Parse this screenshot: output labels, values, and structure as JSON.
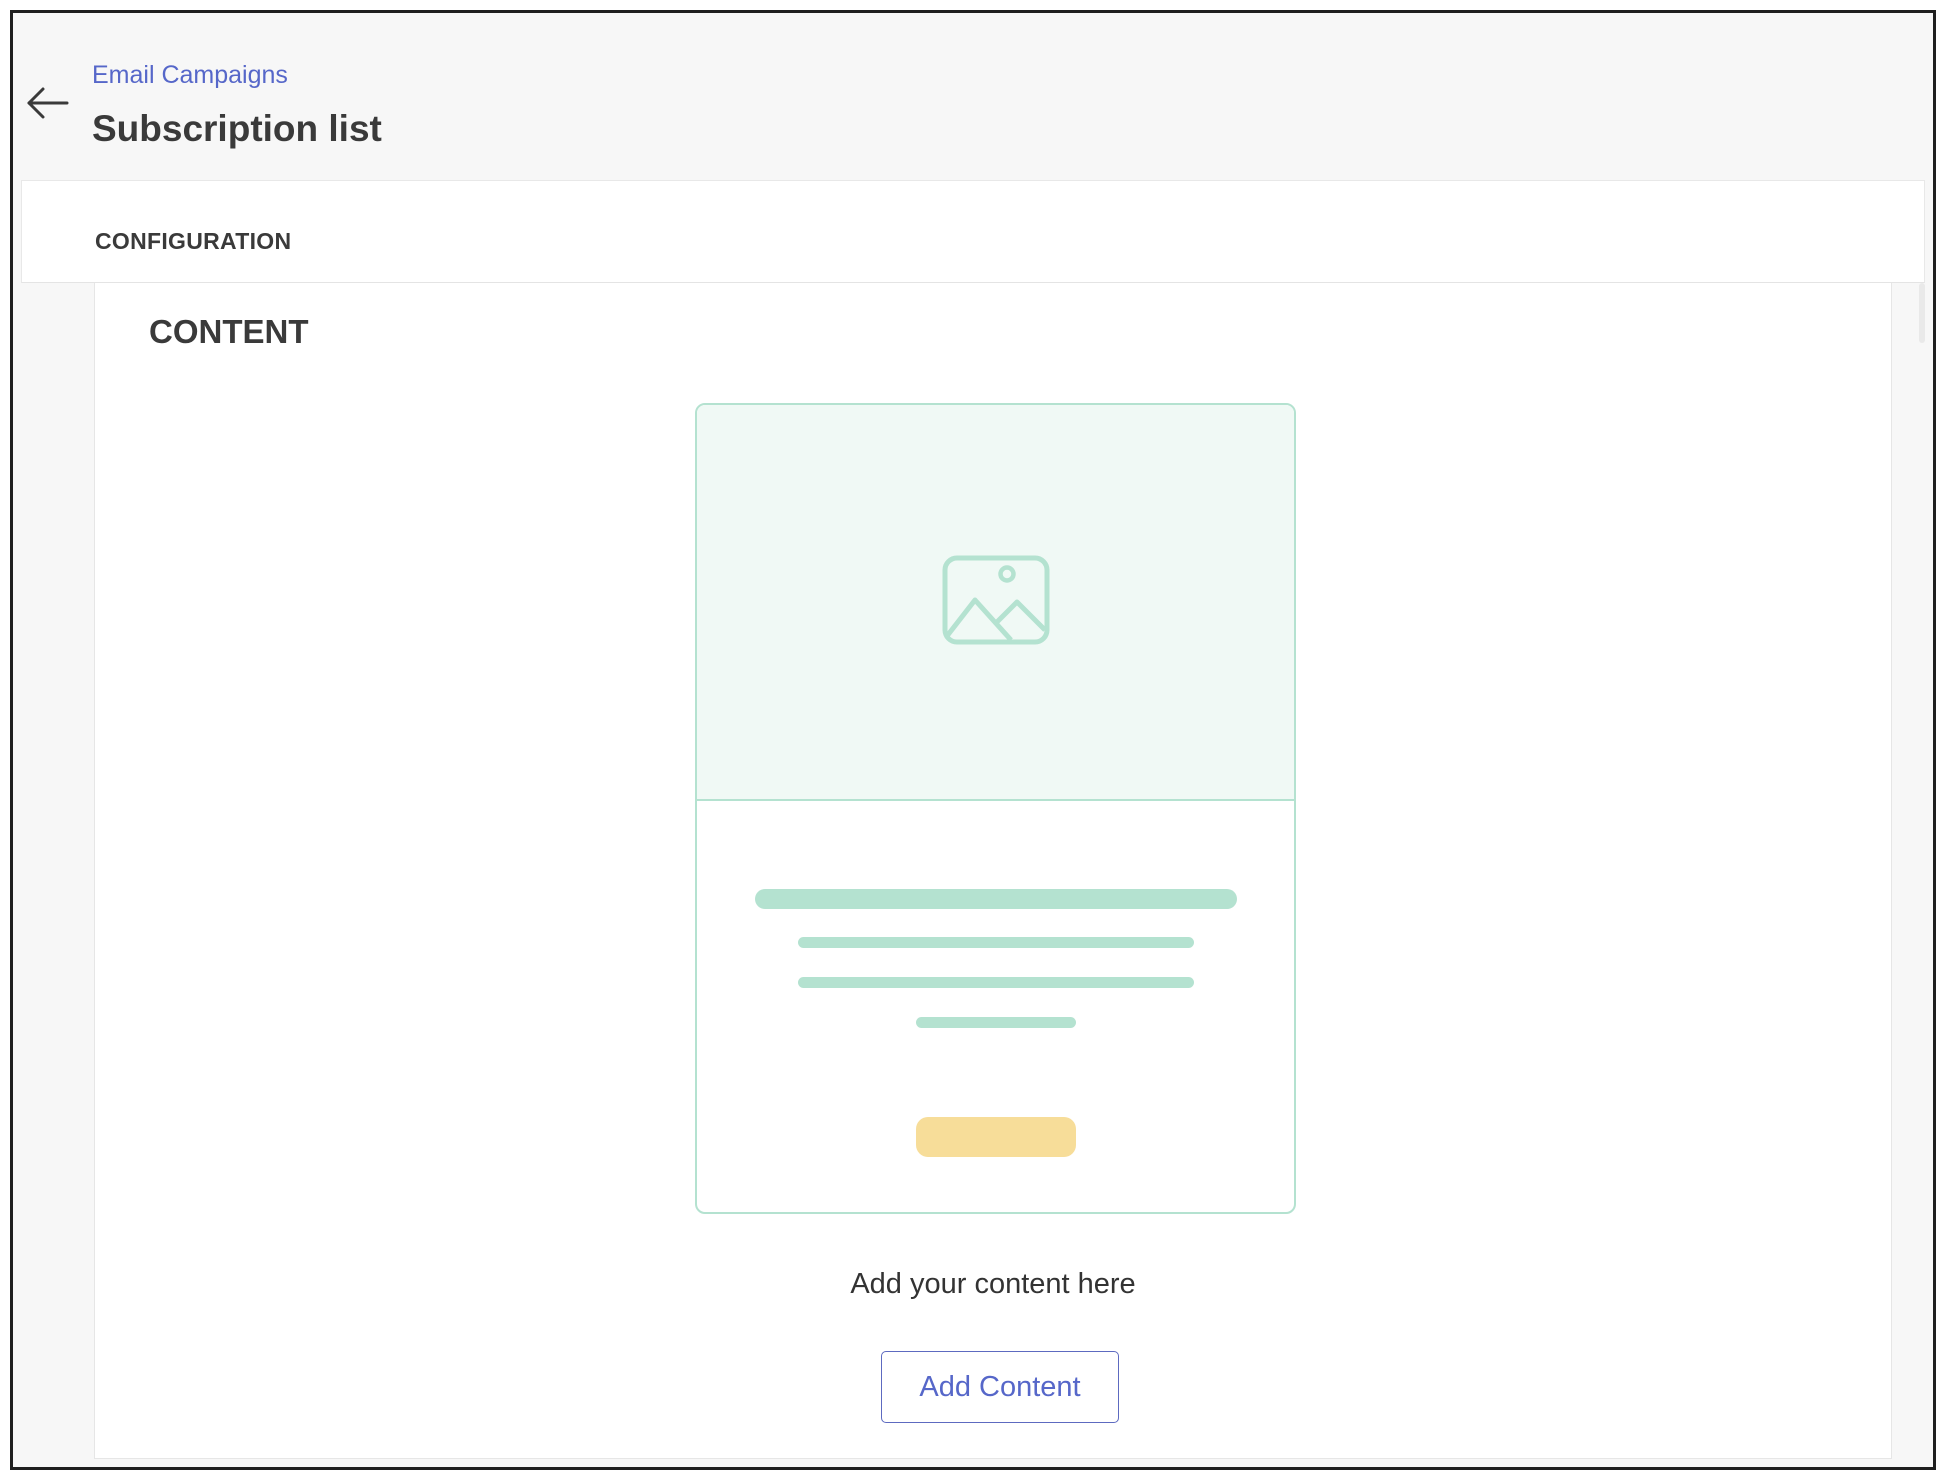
{
  "header": {
    "breadcrumb": "Email Campaigns",
    "title": "Subscription list",
    "back_icon": "arrow-left-icon"
  },
  "config_bar": {
    "label": "CONFIGURATION"
  },
  "content": {
    "heading": "CONTENT",
    "preview": {
      "image_icon": "image-icon"
    },
    "hint": "Add your content here",
    "add_button_label": "Add Content"
  },
  "colors": {
    "accent": "#5667c9",
    "preview_green": "#b4e2d0",
    "preview_green_bg": "#f0f9f5",
    "preview_yellow": "#f7dd99",
    "text_dark": "#3a3a3a"
  }
}
